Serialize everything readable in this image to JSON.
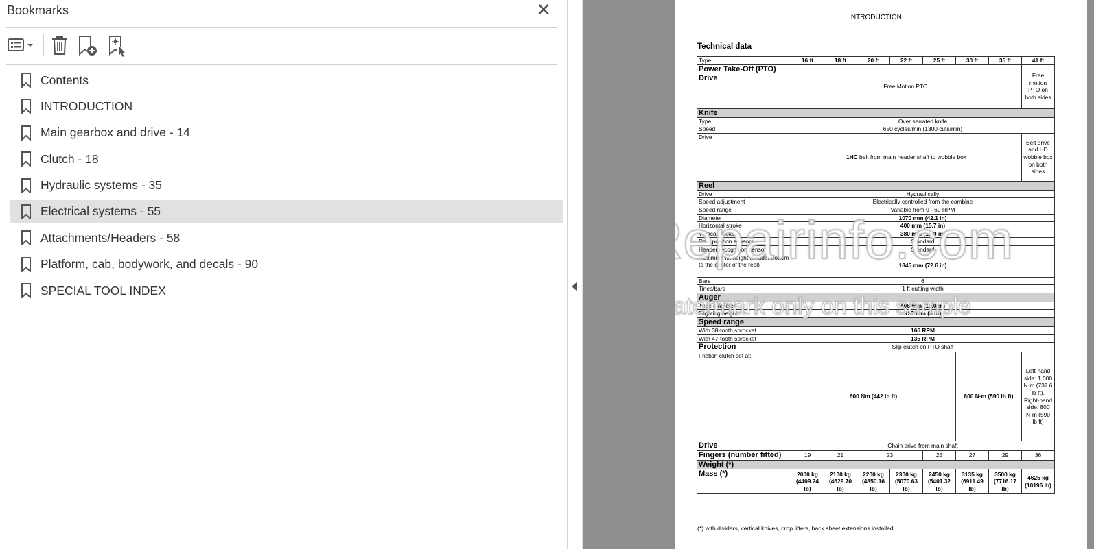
{
  "panel": {
    "title": "Bookmarks",
    "close_glyph": "✕",
    "toolbar": [
      "options-menu-icon",
      "delete-icon",
      "new-bookmark-icon",
      "bookmark-from-selection-icon"
    ],
    "items": [
      {
        "label": "Contents",
        "selected": false
      },
      {
        "label": "INTRODUCTION",
        "selected": false
      },
      {
        "label": "Main gearbox and drive - 14",
        "selected": false
      },
      {
        "label": "Clutch - 18",
        "selected": false
      },
      {
        "label": "Hydraulic systems - 35",
        "selected": false
      },
      {
        "label": "Electrical systems - 55",
        "selected": true
      },
      {
        "label": "Attachments/Headers - 58",
        "selected": false
      },
      {
        "label": "Platform, cab, bodywork, and decals - 90",
        "selected": false
      },
      {
        "label": "SPECIAL TOOL INDEX",
        "selected": false
      }
    ]
  },
  "document": {
    "header": "INTRODUCTION",
    "subtitle": "Technical data",
    "watermark": "eRepairinfo.com",
    "watermark_sub": "watermark only on this sample",
    "footnote": "(*) with dividers, vertical knives, crop lifters, back sheet extensions installed.",
    "table": {
      "type_label": "Type",
      "sizes": [
        "16 ft",
        "18 ft",
        "20 ft",
        "22 ft",
        "25 ft",
        "30 ft",
        "35 ft",
        "41 ft"
      ],
      "pto_label": "Power Take-Off (PTO) Drive",
      "pto_value": "Free Motion PTO.",
      "pto_41": "Free motion PTO on both sides",
      "knife": {
        "section": "Knife",
        "type_label": "Type",
        "type_value": "Over serrated knife",
        "speed_label": "Speed",
        "speed_value": "650 cycles/min (1300 cuts/min)",
        "drive_label": "Drive",
        "drive_value_bold": "1HC",
        "drive_value": " belt from main header shaft to wobble box",
        "drive_41": "Belt drive and HD wobble box on both sides"
      },
      "reel": {
        "section": "Reel",
        "rows": [
          {
            "label": "Drive",
            "value": "Hydraulically",
            "bold": false
          },
          {
            "label": "Speed adjustment",
            "value": "Electrically controlled from the combine",
            "bold": false
          },
          {
            "label": "Speed range",
            "value": "Variable from 0 - 60 RPM",
            "bold": false
          },
          {
            "label": "Diameter",
            "value": "1070 mm (42.1 in)",
            "bold": true
          },
          {
            "label": "Horizontal stroke",
            "value": "400 mm (15.7 in)",
            "bold": true
          },
          {
            "label": "Vertical stroke",
            "value": "380 mm (15.0 in)",
            "bold": true
          },
          {
            "label": "Reel position sensors",
            "value": "Standard",
            "bold": false
          },
          {
            "label": "Header recognition sensor",
            "value": "Standard",
            "bold": false
          },
          {
            "label": "Maximum lift height (header bottom to the center of the reel)",
            "value": "1845 mm (72.6 in)",
            "bold": true
          },
          {
            "label": "Bars",
            "value": "6",
            "bold": false
          },
          {
            "label": "Tines/bars",
            "value": "1 ft cutting width",
            "bold": false
          }
        ]
      },
      "auger": {
        "section": "Auger",
        "rows": [
          {
            "label": "Tube diameter",
            "value": "406 mm (16.0 in)"
          },
          {
            "label": "Flighting height",
            "value": "127 mm (5 in)"
          }
        ]
      },
      "speed_range": {
        "section": "Speed range",
        "rows": [
          {
            "label": "With 38-tooth sprocket",
            "value": "166 RPM"
          },
          {
            "label": "With 47-tooth sprocket",
            "value": "135 RPM"
          }
        ]
      },
      "protection": {
        "label": "Protection",
        "value": "Slip clutch on PTO shaft",
        "friction_label": "Friction clutch set at:",
        "friction_a": "600 Nm (442 lb ft)",
        "friction_b": "800 N·m (590 lb ft)",
        "friction_c": "Left-hand side: 1 000 N·m (737.6 lb ft), Right-hand side: 800 N·m (590 lb ft)"
      },
      "drive": {
        "label": "Drive",
        "value": "Chain drive from main shaft"
      },
      "fingers": {
        "label": "Fingers (number fitted)",
        "values": [
          "19",
          "21",
          "23",
          "25",
          "27",
          "29",
          "36"
        ]
      },
      "weight": {
        "section": "Weight (*)",
        "mass_label": "Mass (*)",
        "values": [
          "2000 kg (4409.24 lb)",
          "2100 kg (4629.70 lb)",
          "2200 kg (4850.16 lb)",
          "2300 kg (5070.63 lb)",
          "2450 kg (5401.32 lb)",
          "3135 kg (6911.49 lb)",
          "3500 kg (7716.17 lb)",
          "4625 kg (10196 lb)"
        ]
      }
    }
  }
}
